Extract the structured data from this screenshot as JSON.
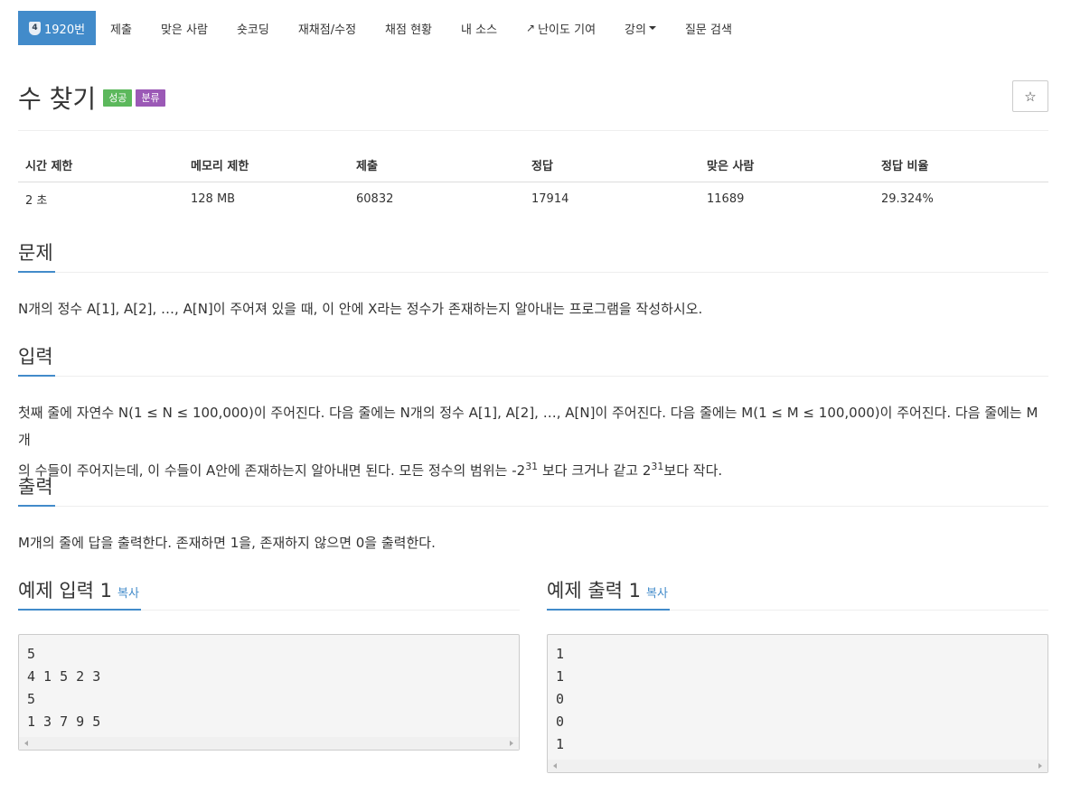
{
  "nav": {
    "problem_number": "1920번",
    "tier_badge": "4",
    "items": [
      "제출",
      "맞은 사람",
      "숏코딩",
      "재채점/수정",
      "채점 현황",
      "내 소스",
      "난이도 기여",
      "강의",
      "질문 검색"
    ]
  },
  "header": {
    "title": "수 찾기",
    "label_success": "성공",
    "label_info": "분류",
    "star_icon": "☆"
  },
  "info_table": {
    "headers": [
      "시간 제한",
      "메모리 제한",
      "제출",
      "정답",
      "맞은 사람",
      "정답 비율"
    ],
    "values": [
      "2 초",
      "128 MB",
      "60832",
      "17914",
      "11689",
      "29.324%"
    ]
  },
  "description": {
    "title": "문제",
    "text": "N개의 정수 A[1], A[2], …, A[N]이 주어져 있을 때, 이 안에 X라는 정수가 존재하는지 알아내는 프로그램을 작성하시오."
  },
  "input": {
    "title": "입력",
    "line1": "첫째 줄에 자연수 N(1 ≤ N ≤ 100,000)이 주어진다. 다음 줄에는 N개의 정수 A[1], A[2], …, A[N]이 주어진다. 다음 줄에는 M(1 ≤ M ≤ 100,000)이 주어진다. 다음 줄에는 M개",
    "line2_a": "의 수들이 주어지는데, 이 수들이 A안에 존재하는지 알아내면 된다. 모든 정수의 범위는 -2",
    "exp1": "31",
    "line2_b": " 보다 크거나 같고 2",
    "exp2": "31",
    "line2_c": "보다 작다."
  },
  "output": {
    "title": "출력",
    "text": "M개의 줄에 답을 출력한다. 존재하면 1을, 존재하지 않으면 0을 출력한다."
  },
  "sample_input": {
    "title": "예제 입력 1",
    "copy": "복사",
    "content": "5\n4 1 5 2 3\n5\n1 3 7 9 5"
  },
  "sample_output": {
    "title": "예제 출력 1",
    "copy": "복사",
    "content": "1\n1\n0\n0\n1"
  },
  "colors": {
    "primary": "#428bca",
    "success": "#5cb85c",
    "info": "#9b59b6"
  }
}
